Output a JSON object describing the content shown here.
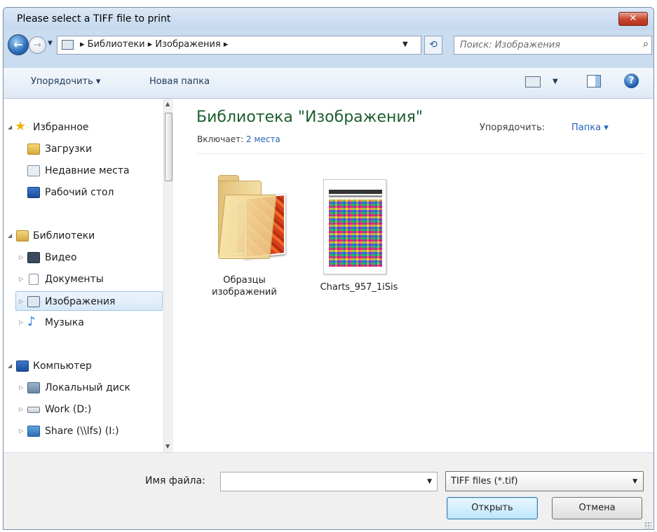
{
  "window": {
    "title": "Please select a TIFF file to print"
  },
  "address_bar": {
    "path": [
      "Библиотеки",
      "Изображения"
    ],
    "display": "▸ Библиотеки ▸ Изображения ▸"
  },
  "search": {
    "placeholder": "Поиск: Изображения"
  },
  "toolbar": {
    "organize_label": "Упорядочить ▾",
    "new_folder_label": "Новая папка"
  },
  "sidebar": {
    "favorites": {
      "label": "Избранное",
      "items": [
        {
          "label": "Загрузки",
          "icon": "downloads-icon"
        },
        {
          "label": "Недавние места",
          "icon": "recent-places-icon"
        },
        {
          "label": "Рабочий стол",
          "icon": "desktop-icon"
        }
      ]
    },
    "libraries": {
      "label": "Библиотеки",
      "items": [
        {
          "label": "Видео",
          "icon": "video-icon"
        },
        {
          "label": "Документы",
          "icon": "documents-icon"
        },
        {
          "label": "Изображения",
          "icon": "pictures-icon",
          "selected": true
        },
        {
          "label": "Музыка",
          "icon": "music-icon"
        }
      ]
    },
    "computer": {
      "label": "Компьютер",
      "items": [
        {
          "label": "Локальный диск",
          "icon": "local-disk-icon"
        },
        {
          "label": "Work (D:)",
          "icon": "drive-icon"
        },
        {
          "label": "Share (\\\\lfs) (I:)",
          "icon": "network-drive-icon"
        }
      ]
    }
  },
  "library_header": {
    "title": "Библиотека \"Изображения\"",
    "includes_label": "Включает:",
    "includes_link": "2 места",
    "arrange_label": "Упорядочить:",
    "arrange_value": "Папка ▾"
  },
  "files": [
    {
      "name_line1": "Образцы",
      "name_line2": "изображений",
      "type": "folder"
    },
    {
      "name_line1": "Charts_957_1iSis",
      "name_line2": "",
      "type": "tiff"
    }
  ],
  "bottom": {
    "filename_label": "Имя файла:",
    "filename_value": "",
    "filetype_value": "TIFF files (*.tif)",
    "open_label": "Открыть",
    "cancel_label": "Отмена"
  },
  "colors": {
    "library_title": "#1e5f2e",
    "link": "#1f63b8",
    "close_button": "#c7432a"
  }
}
